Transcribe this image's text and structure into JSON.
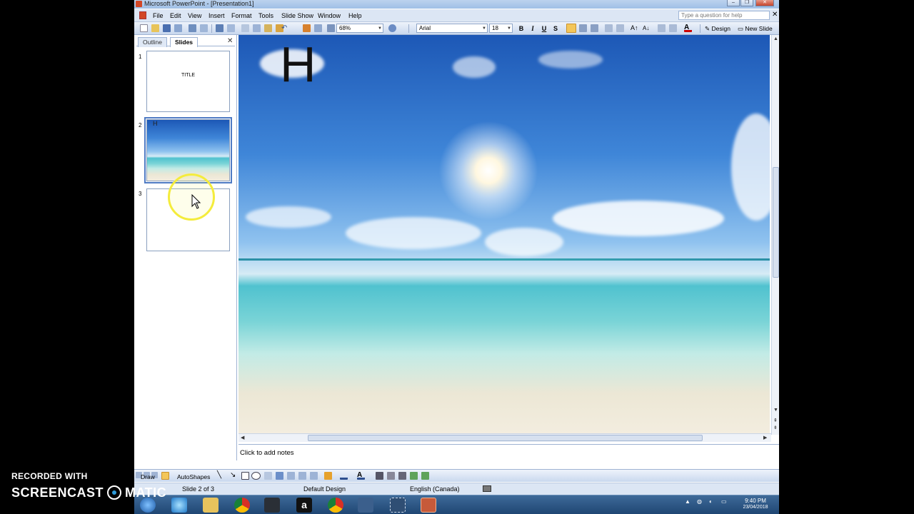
{
  "window": {
    "title": "Microsoft PowerPoint - [Presentation1]"
  },
  "menu": {
    "items": [
      "File",
      "Edit",
      "View",
      "Insert",
      "Format",
      "Tools",
      "Slide Show",
      "Window",
      "Help"
    ],
    "help_placeholder": "Type a question for help"
  },
  "toolbar": {
    "zoom": "68%",
    "font": "Arial",
    "font_size": "18",
    "bold": "B",
    "italic": "I",
    "underline": "U",
    "shadow": "S",
    "design_label": "Design",
    "new_slide_label": "New Slide"
  },
  "left_pane": {
    "tabs": [
      "Outline",
      "Slides"
    ],
    "active_tab": "Slides",
    "slides": [
      {
        "number": "1",
        "text": "TITLE"
      },
      {
        "number": "2",
        "text": "H"
      },
      {
        "number": "3",
        "text": ""
      }
    ]
  },
  "slide": {
    "text": "H"
  },
  "notes": {
    "placeholder": "Click to add notes"
  },
  "drawbar": {
    "draw_label": "Draw",
    "autoshapes_label": "AutoShapes"
  },
  "status": {
    "slide": "Slide 2 of 3",
    "design": "Default Design",
    "language": "English (Canada)"
  },
  "taskbar": {
    "time": "9:40 PM",
    "date": "23/04/2018"
  },
  "watermark": {
    "line1": "RECORDED WITH",
    "brand_left": "SCREENCAST",
    "brand_right": "MATIC"
  },
  "colors": {
    "accent": "#4f7bc4",
    "cursor_ring": "#f4ec3c"
  }
}
